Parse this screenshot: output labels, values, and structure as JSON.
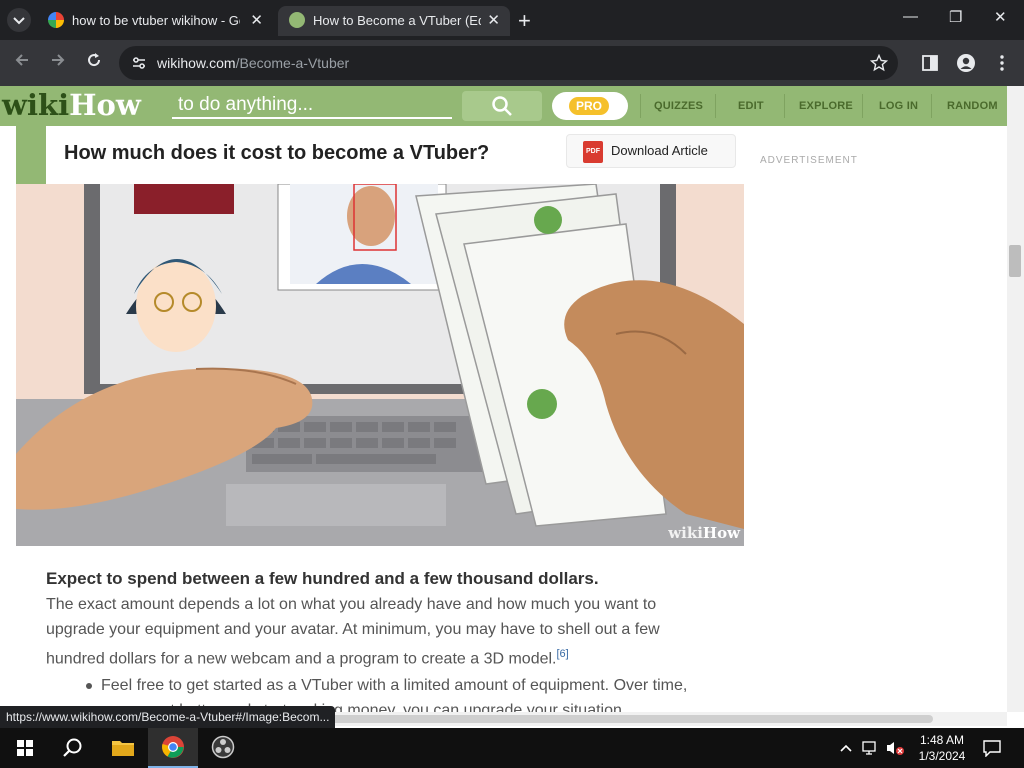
{
  "browser": {
    "tabs": [
      {
        "title": "how to be vtuber wikihow - Google Search",
        "active": false
      },
      {
        "title": "How to Become a VTuber (Equipment, Software & Costs)",
        "active": true
      }
    ],
    "url_domain": "wikihow.com",
    "url_path": "/Become-a-Vtuber",
    "status_url": "https://www.wikihow.com/Become-a-Vtuber#/Image:Becom..."
  },
  "icons": {
    "tab_dropdown": "chevron-down-icon",
    "new_tab": "plus-icon",
    "back": "arrow-left-icon",
    "forward": "arrow-right-icon",
    "reload": "reload-icon",
    "site_info": "tune-icon",
    "bookmark": "star-icon",
    "side_panel": "side-panel-icon",
    "profile": "profile-icon",
    "menu": "kebab-icon"
  },
  "wikihow": {
    "logo_wiki": "wiki",
    "logo_how": "How",
    "search_placeholder": "to do anything...",
    "pro_label": "PRO",
    "nav": [
      "QUIZZES",
      "EDIT",
      "EXPLORE",
      "LOG IN",
      "RANDOM"
    ],
    "colors": {
      "header_green": "#93b874",
      "pro_yellow": "#f5c02b"
    }
  },
  "article": {
    "headline": "How much does it cost to become a VTuber?",
    "download_label": "Download Article",
    "pdf_badge": "PDF",
    "advertisement": "ADVERTISEMENT",
    "watermark_wiki": "wiki",
    "watermark_how": "How",
    "step_title": "Expect to spend between a few hundred and a few thousand dollars.",
    "step_body": "The exact amount depends a lot on what you already have and how much you want to upgrade your equipment and your avatar. At minimum, you may have to shell out a few hundred dollars for a new webcam and a program to create a 3D model.",
    "citation": "[6]",
    "bullet": "Feel free to get started as a VTuber with a limited amount of equipment. Over time, as you get better and start making money, you can upgrade your situation."
  },
  "taskbar": {
    "time": "1:48 AM",
    "date": "1/3/2024",
    "apps": [
      "windows-start",
      "search",
      "file-explorer",
      "chrome",
      "obs"
    ]
  }
}
